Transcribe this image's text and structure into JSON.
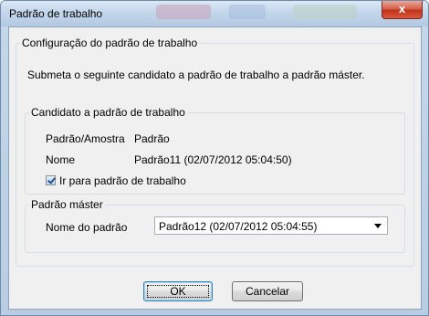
{
  "window": {
    "title": "Padrão de trabalho",
    "close_glyph": "x"
  },
  "config": {
    "legend": "Configuração do padrão de trabalho",
    "instruction": "Submeta o seguinte candidato a padrão de trabalho a padrão máster."
  },
  "candidate": {
    "legend": "Candidato a padrão de trabalho",
    "type_label": "Padrão/Amostra",
    "type_value": "Padrão",
    "name_label": "Nome",
    "name_value": "Padrão11 (02/07/2012 05:04:50)",
    "goto_label": "Ir para padrão de trabalho",
    "goto_checked": true
  },
  "master": {
    "legend": "Padrão máster",
    "name_label": "Nome do padrão",
    "selected": "Padrão12 (02/07/2012 05:04:55)"
  },
  "buttons": {
    "ok": "OK",
    "cancel": "Cancelar"
  }
}
